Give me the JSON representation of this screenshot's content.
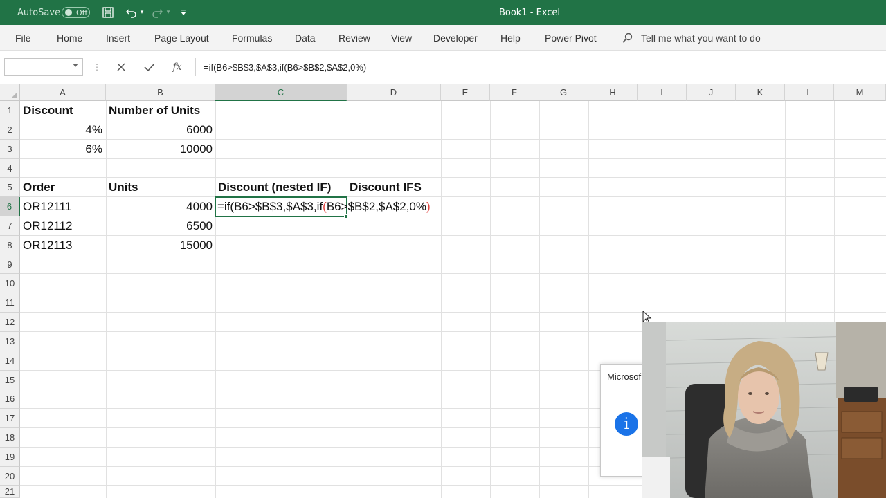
{
  "titlebar": {
    "autosave_label": "AutoSave",
    "autosave_state": "Off",
    "title": "Book1  -  Excel",
    "accent": "#217346"
  },
  "ribbon": {
    "tabs": [
      "File",
      "Home",
      "Insert",
      "Page Layout",
      "Formulas",
      "Data",
      "Review",
      "View",
      "Developer",
      "Help",
      "Power Pivot"
    ],
    "tell_me": "Tell me what you want to do"
  },
  "formula_bar": {
    "name_box": "",
    "formula": "=if(B6>$B$3,$A$3,if(B6>$B$2,$A$2,0%)"
  },
  "grid": {
    "columns": [
      "A",
      "B",
      "C",
      "D",
      "E",
      "F",
      "G",
      "H",
      "I",
      "J",
      "K",
      "L",
      "M"
    ],
    "rows": [
      "1",
      "2",
      "3",
      "4",
      "5",
      "6",
      "7",
      "8",
      "9",
      "10",
      "11",
      "12",
      "13",
      "14",
      "15",
      "16",
      "17",
      "18",
      "19",
      "20",
      "21"
    ],
    "active_column": "C",
    "active_row": "6",
    "cells": {
      "A1": "Discount",
      "B1": "Number of Units",
      "A2": "4%",
      "B2": "6000",
      "A3": "6%",
      "B3": "10000",
      "A5": "Order",
      "B5": "Units",
      "C5": "Discount (nested IF)",
      "D5": "Discount IFS",
      "A6": "OR12111",
      "B6": "4000",
      "A7": "OR12112",
      "B7": "6500",
      "A8": "OR12113",
      "B8": "15000"
    },
    "editing": {
      "part1": "=if(B6>$B$3,$A$3,if",
      "part2": "(",
      "part3": "B6>$B$2,$A$2,0%",
      "part4": ")"
    }
  },
  "dialog": {
    "title": "Microsof",
    "icon": "info-icon"
  },
  "webcam": {
    "description_icon": "presenter-video"
  }
}
